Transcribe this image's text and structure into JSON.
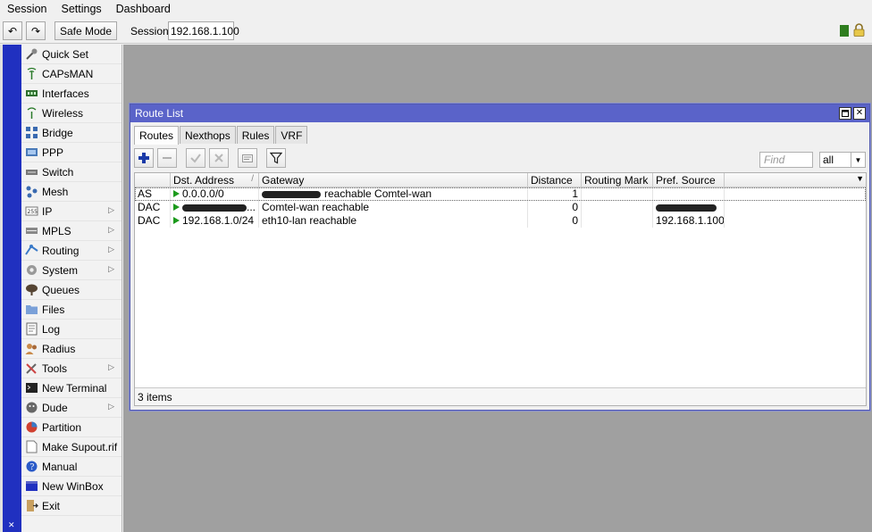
{
  "menubar": {
    "items": [
      "Session",
      "Settings",
      "Dashboard"
    ]
  },
  "toolbar": {
    "undo_label": "↶",
    "redo_label": "↷",
    "safe_mode_label": "Safe Mode",
    "session_label": "Session:",
    "session_value": "192.168.1.100"
  },
  "sidebar": {
    "items": [
      {
        "label": "Quick Set",
        "icon": "quick-set-icon",
        "submenu": false
      },
      {
        "label": "CAPsMAN",
        "icon": "capsman-icon",
        "submenu": false
      },
      {
        "label": "Interfaces",
        "icon": "interfaces-icon",
        "submenu": false
      },
      {
        "label": "Wireless",
        "icon": "wireless-icon",
        "submenu": false
      },
      {
        "label": "Bridge",
        "icon": "bridge-icon",
        "submenu": false
      },
      {
        "label": "PPP",
        "icon": "ppp-icon",
        "submenu": false
      },
      {
        "label": "Switch",
        "icon": "switch-icon",
        "submenu": false
      },
      {
        "label": "Mesh",
        "icon": "mesh-icon",
        "submenu": false
      },
      {
        "label": "IP",
        "icon": "ip-icon",
        "submenu": true
      },
      {
        "label": "MPLS",
        "icon": "mpls-icon",
        "submenu": true
      },
      {
        "label": "Routing",
        "icon": "routing-icon",
        "submenu": true
      },
      {
        "label": "System",
        "icon": "system-icon",
        "submenu": true
      },
      {
        "label": "Queues",
        "icon": "queues-icon",
        "submenu": false
      },
      {
        "label": "Files",
        "icon": "files-icon",
        "submenu": false
      },
      {
        "label": "Log",
        "icon": "log-icon",
        "submenu": false
      },
      {
        "label": "Radius",
        "icon": "radius-icon",
        "submenu": false
      },
      {
        "label": "Tools",
        "icon": "tools-icon",
        "submenu": true
      },
      {
        "label": "New Terminal",
        "icon": "terminal-icon",
        "submenu": false
      },
      {
        "label": "Dude",
        "icon": "dude-icon",
        "submenu": true
      },
      {
        "label": "Partition",
        "icon": "partition-icon",
        "submenu": false
      },
      {
        "label": "Make Supout.rif",
        "icon": "supout-icon",
        "submenu": false
      },
      {
        "label": "Manual",
        "icon": "manual-icon",
        "submenu": false
      },
      {
        "label": "New WinBox",
        "icon": "winbox-icon",
        "submenu": false
      },
      {
        "label": "Exit",
        "icon": "exit-icon",
        "submenu": false
      }
    ]
  },
  "window": {
    "title": "Route List",
    "tabs": [
      "Routes",
      "Nexthops",
      "Rules",
      "VRF"
    ],
    "active_tab": "Routes",
    "find_placeholder": "Find",
    "filter_value": "all",
    "columns": [
      "",
      "Dst. Address",
      "Gateway",
      "Distance",
      "Routing Mark",
      "Pref. Source"
    ],
    "rows": [
      {
        "flags": "AS",
        "dst": "0.0.0.0/0",
        "dst_redacted": false,
        "gateway": "reachable Comtel-wan",
        "gateway_redacted": true,
        "distance": "1",
        "routing_mark": "",
        "pref_source": "",
        "pref_redacted": false
      },
      {
        "flags": "DAC",
        "dst": "...",
        "dst_redacted": true,
        "gateway": "Comtel-wan reachable",
        "gateway_redacted": false,
        "distance": "0",
        "routing_mark": "",
        "pref_source": "",
        "pref_redacted": true
      },
      {
        "flags": "DAC",
        "dst": "192.168.1.0/24",
        "dst_redacted": false,
        "gateway": "eth10-lan reachable",
        "gateway_redacted": false,
        "distance": "0",
        "routing_mark": "",
        "pref_source": "192.168.1.100",
        "pref_redacted": false
      }
    ],
    "footer": "3 items"
  },
  "colors": {
    "accent": "#5a63c9",
    "strip": "#2030c0",
    "flag_green": "#1c9a1c",
    "status_green": "#2e7d1e"
  }
}
